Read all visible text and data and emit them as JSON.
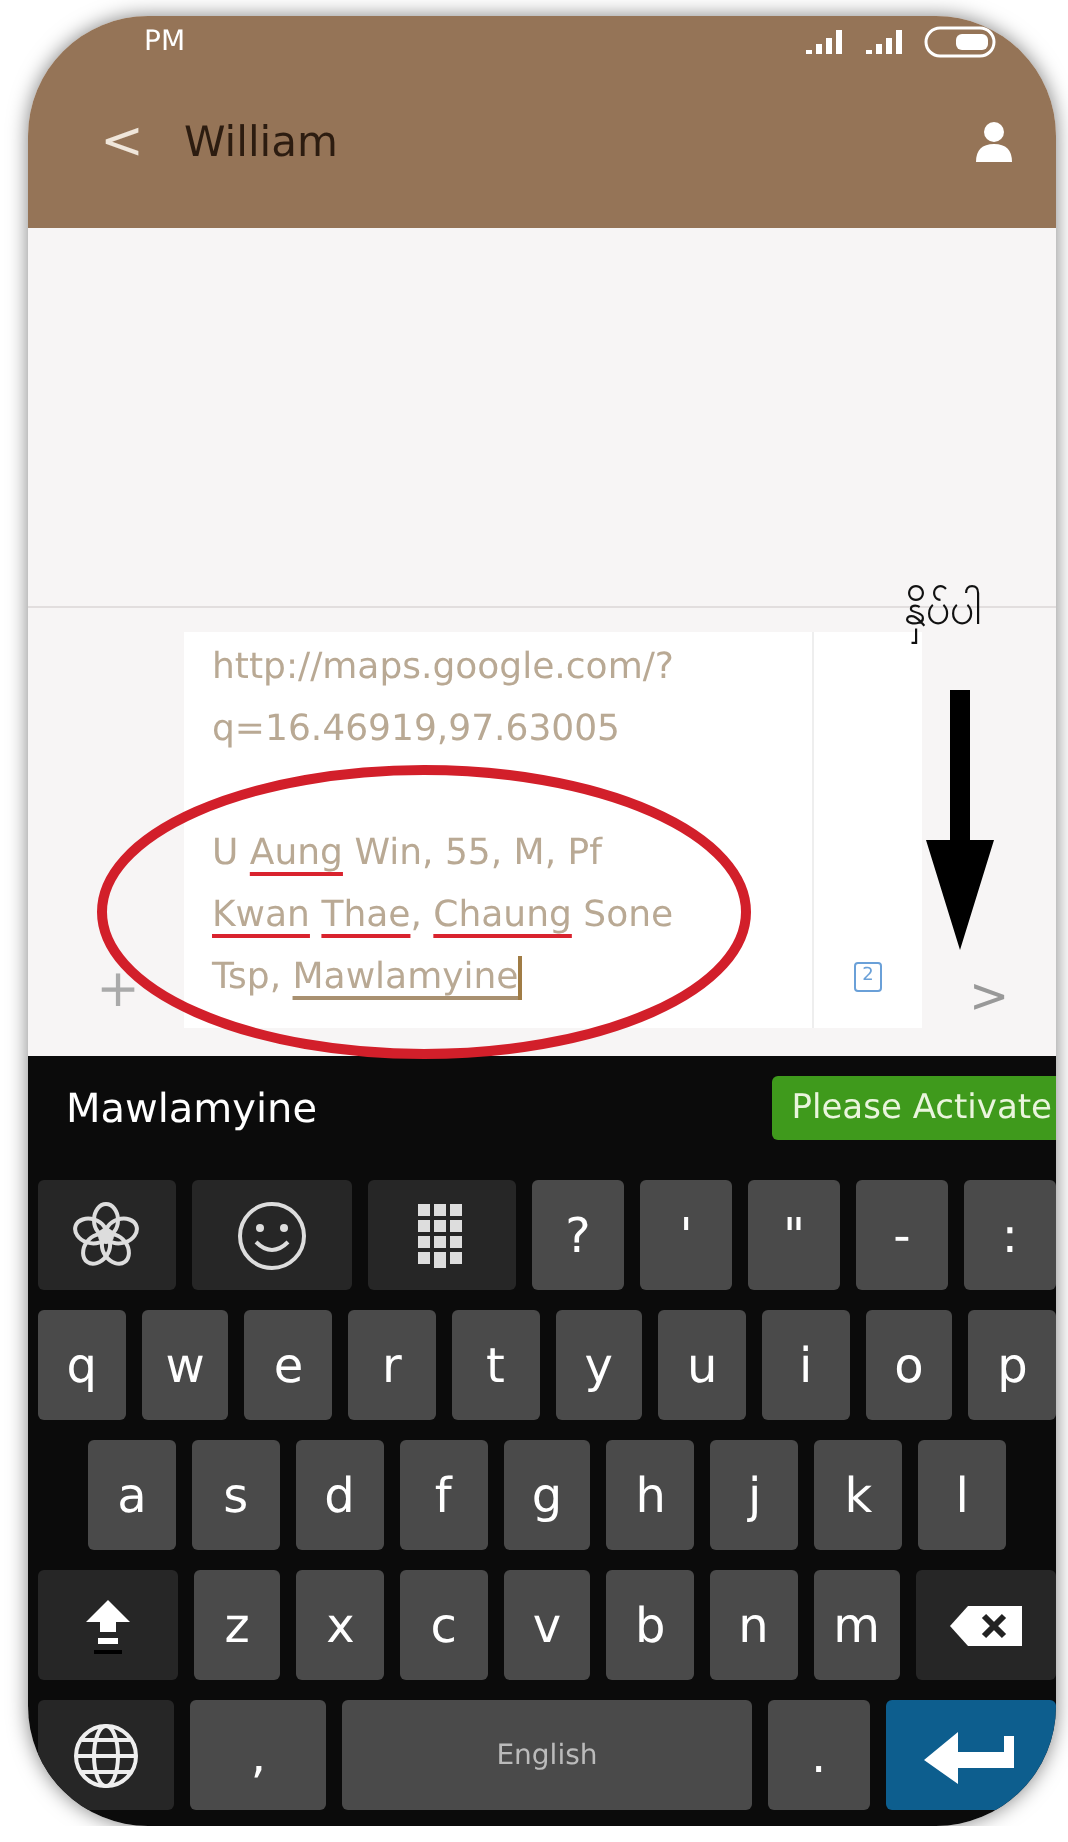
{
  "status_bar": {
    "time": "PM"
  },
  "header": {
    "back": "<",
    "title": "William"
  },
  "compose": {
    "plus": "+",
    "paragraphs": [
      [
        [
          {
            "text": "http://maps.google.com/?",
            "misspelled": false,
            "composing": false
          }
        ],
        [
          {
            "text": "q=16.46919,97.63005",
            "misspelled": false,
            "composing": false
          }
        ]
      ],
      [
        [
          {
            "text": "U ",
            "misspelled": false,
            "composing": false
          },
          {
            "text": "Aung",
            "misspelled": true,
            "composing": false
          },
          {
            "text": " Win, 55, M, Pf",
            "misspelled": false,
            "composing": false
          }
        ],
        [
          {
            "text": "Kwan",
            "misspelled": true,
            "composing": false
          },
          {
            "text": " Thae",
            "misspelled": true,
            "composing": false
          },
          {
            "text": ", ",
            "misspelled": false,
            "composing": false
          },
          {
            "text": "Chaung",
            "misspelled": true,
            "composing": false
          },
          {
            "text": " Sone",
            "misspelled": false,
            "composing": false
          }
        ],
        [
          {
            "text": "Tsp, ",
            "misspelled": false,
            "composing": false
          },
          {
            "text": "Mawlamyine",
            "misspelled": false,
            "composing": true
          }
        ]
      ]
    ],
    "counter": "2",
    "send": ">"
  },
  "annotation": {
    "label": "နှိပ်ပါ"
  },
  "suggestion_bar": {
    "word": "Mawlamyine",
    "button": "Please Activate"
  },
  "keyboard": {
    "symbol_keys": [
      {
        "kind": "flower"
      },
      {
        "kind": "emoji"
      },
      {
        "kind": "numpad"
      },
      {
        "kind": "char",
        "label": "?"
      },
      {
        "kind": "char",
        "label": "'"
      },
      {
        "kind": "char",
        "label": "\""
      },
      {
        "kind": "char",
        "label": "-"
      },
      {
        "kind": "char",
        "label": ":"
      }
    ],
    "rows": [
      [
        {
          "kind": "char",
          "label": "q"
        },
        {
          "kind": "char",
          "label": "w"
        },
        {
          "kind": "char",
          "label": "e"
        },
        {
          "kind": "char",
          "label": "r"
        },
        {
          "kind": "char",
          "label": "t"
        },
        {
          "kind": "char",
          "label": "y"
        },
        {
          "kind": "char",
          "label": "u"
        },
        {
          "kind": "char",
          "label": "i"
        },
        {
          "kind": "char",
          "label": "o"
        },
        {
          "kind": "char",
          "label": "p"
        }
      ],
      [
        {
          "kind": "char",
          "label": "a"
        },
        {
          "kind": "char",
          "label": "s"
        },
        {
          "kind": "char",
          "label": "d"
        },
        {
          "kind": "char",
          "label": "f"
        },
        {
          "kind": "char",
          "label": "g"
        },
        {
          "kind": "char",
          "label": "h"
        },
        {
          "kind": "char",
          "label": "j"
        },
        {
          "kind": "char",
          "label": "k"
        },
        {
          "kind": "char",
          "label": "l"
        }
      ],
      [
        {
          "kind": "shift"
        },
        {
          "kind": "char",
          "label": "z"
        },
        {
          "kind": "char",
          "label": "x"
        },
        {
          "kind": "char",
          "label": "c"
        },
        {
          "kind": "char",
          "label": "v"
        },
        {
          "kind": "char",
          "label": "b"
        },
        {
          "kind": "char",
          "label": "n"
        },
        {
          "kind": "char",
          "label": "m"
        },
        {
          "kind": "backspace"
        }
      ]
    ],
    "bottom_keys": [
      {
        "kind": "globe"
      },
      {
        "kind": "char",
        "label": ","
      },
      {
        "kind": "space",
        "label": "English"
      },
      {
        "kind": "char",
        "label": "."
      },
      {
        "kind": "enter"
      }
    ]
  }
}
